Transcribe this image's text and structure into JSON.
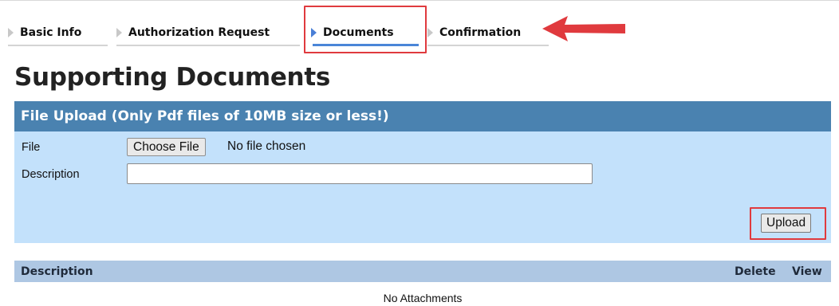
{
  "tabs": [
    {
      "label": "Basic Info",
      "active": false
    },
    {
      "label": "Authorization Request",
      "active": false
    },
    {
      "label": "Documents",
      "active": true
    },
    {
      "label": "Confirmation",
      "active": false
    }
  ],
  "page_title": "Supporting Documents",
  "upload_panel": {
    "header": "File Upload (Only Pdf files of 10MB size or less!)",
    "file_label": "File",
    "choose_file_label": "Choose File",
    "no_file_text": "No file chosen",
    "description_label": "Description",
    "description_value": "",
    "upload_button_label": "Upload"
  },
  "attachments_table": {
    "columns": [
      "Description",
      "Delete",
      "View"
    ],
    "empty_text": "No Attachments"
  },
  "annotation_color": "#e03a3e",
  "header_color": "#4a82b0",
  "panel_color": "#c3e1fb"
}
